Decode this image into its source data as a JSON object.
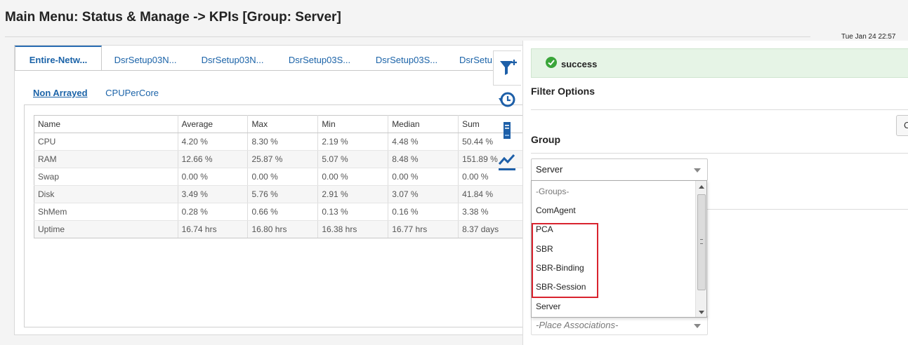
{
  "page": {
    "title": "Main Menu: Status & Manage -> KPIs [Group: Server]",
    "timestamp": "Tue Jan 24 22:57"
  },
  "tabs": [
    {
      "label": "Entire-Netw...",
      "active": true
    },
    {
      "label": "DsrSetup03N..."
    },
    {
      "label": "DsrSetup03N..."
    },
    {
      "label": "DsrSetup03S..."
    },
    {
      "label": "DsrSetup03S..."
    },
    {
      "label": "DsrSetu"
    }
  ],
  "subtabs": [
    {
      "label": "Non Arrayed",
      "active": true
    },
    {
      "label": "CPUPerCore"
    }
  ],
  "table": {
    "columns": [
      "Name",
      "Average",
      "Max",
      "Min",
      "Median",
      "Sum"
    ],
    "rows": [
      [
        "CPU",
        "4.20 %",
        "8.30 %",
        "2.19 %",
        "4.48 %",
        "50.44 %"
      ],
      [
        "RAM",
        "12.66 %",
        "25.87 %",
        "5.07 %",
        "8.48 %",
        "151.89 %"
      ],
      [
        "Swap",
        "0.00 %",
        "0.00 %",
        "0.00 %",
        "0.00 %",
        "0.00 %"
      ],
      [
        "Disk",
        "3.49 %",
        "5.76 %",
        "2.91 %",
        "3.07 %",
        "41.84 %"
      ],
      [
        "ShMem",
        "0.28 %",
        "0.66 %",
        "0.13 %",
        "0.16 %",
        "3.38 %"
      ],
      [
        "Uptime",
        "16.74 hrs",
        "16.80 hrs",
        "16.38 hrs",
        "16.77 hrs",
        "8.37 days"
      ]
    ]
  },
  "side_icons": [
    "filter-add-icon",
    "history-icon",
    "server-icon",
    "trend-chart-icon"
  ],
  "filter_panel": {
    "status": "success",
    "title": "Filter Options",
    "side_button_label": "C",
    "group_label": "Group",
    "group_value": "Server",
    "place_placeholder": "-Place Associations-"
  },
  "dropdown": {
    "options": [
      "-Groups-",
      "ComAgent",
      "PCA",
      "SBR",
      "SBR-Binding",
      "SBR-Session",
      "Server"
    ]
  },
  "colors": {
    "link": "#1b63a8",
    "success_bg": "#e6f4e6",
    "success_icon": "#3aa53a",
    "highlight": "#d9232e"
  }
}
